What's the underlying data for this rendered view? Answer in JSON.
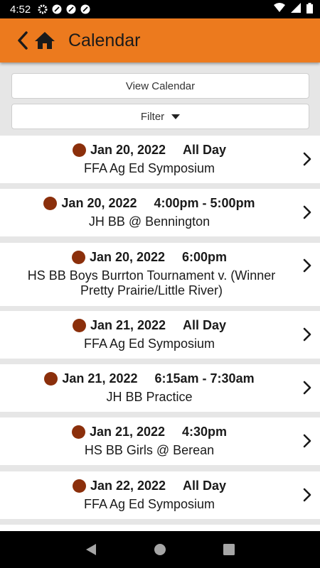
{
  "status": {
    "time": "4:52"
  },
  "appbar": {
    "title": "Calendar"
  },
  "buttons": {
    "view_calendar": "View Calendar",
    "filter": "Filter"
  },
  "events": [
    {
      "date": "Jan 20, 2022",
      "time": "All Day",
      "name": "FFA Ag Ed Symposium"
    },
    {
      "date": "Jan 20, 2022",
      "time": "4:00pm - 5:00pm",
      "name": "JH BB @ Bennington"
    },
    {
      "date": "Jan 20, 2022",
      "time": "6:00pm",
      "name": "HS BB Boys Burrton Tournament v. (Winner Pretty Prairie/Little River)"
    },
    {
      "date": "Jan 21, 2022",
      "time": "All Day",
      "name": "FFA Ag Ed Symposium"
    },
    {
      "date": "Jan 21, 2022",
      "time": "6:15am - 7:30am",
      "name": "JH BB Practice"
    },
    {
      "date": "Jan 21, 2022",
      "time": "4:30pm",
      "name": "HS BB Girls @ Berean"
    },
    {
      "date": "Jan 22, 2022",
      "time": "All Day",
      "name": "FFA Ag Ed Symposium"
    }
  ],
  "colors": {
    "accent": "#ec7a1e",
    "dot": "#8b2f0b"
  }
}
